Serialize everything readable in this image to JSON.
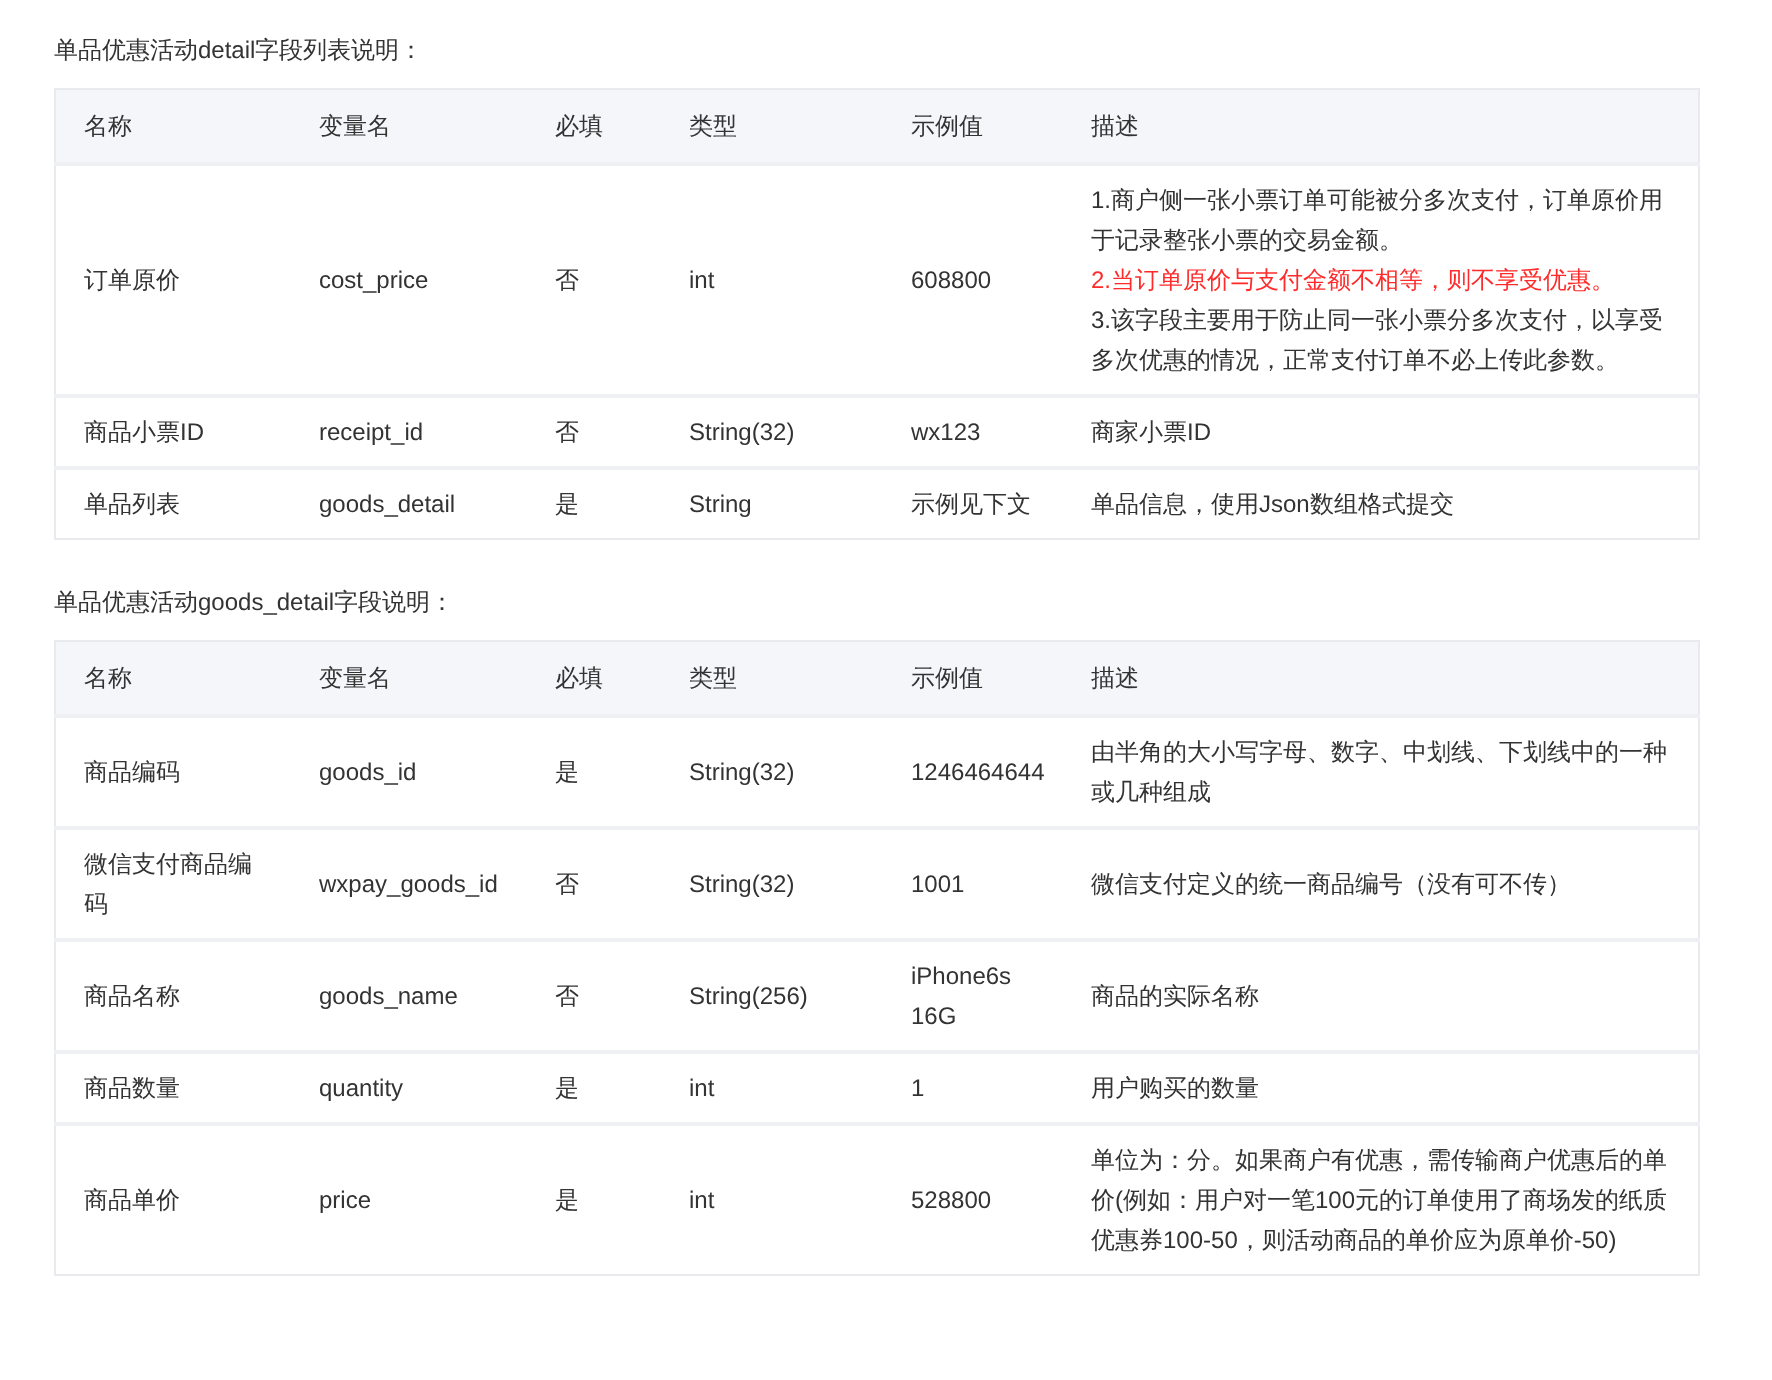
{
  "sections": [
    {
      "title": "单品优惠活动detail字段列表说明：",
      "columns": [
        "名称",
        "变量名",
        "必填",
        "类型",
        "示例值",
        "描述"
      ],
      "rows": [
        {
          "cells": [
            "订单原价",
            "cost_price",
            "否",
            "int",
            "608800"
          ],
          "description": [
            {
              "text": "1.商户侧一张小票订单可能被分多次支付，订单原价用于记录整张小票的交易金额。",
              "kind": "normal"
            },
            {
              "text": "2.当订单原价与支付金额不相等，则不享受优惠。",
              "kind": "warning"
            },
            {
              "text": "3.该字段主要用于防止同一张小票分多次支付，以享受多次优惠的情况，正常支付订单不必上传此参数。",
              "kind": "normal"
            }
          ]
        },
        {
          "cells": [
            "商品小票ID",
            "receipt_id",
            "否",
            "String(32)",
            "wx123"
          ],
          "description": [
            {
              "text": "商家小票ID",
              "kind": "normal"
            }
          ]
        },
        {
          "cells": [
            "单品列表",
            "goods_detail",
            "是",
            "String",
            "示例见下文"
          ],
          "description": [
            {
              "text": "单品信息，使用Json数组格式提交",
              "kind": "normal"
            }
          ]
        }
      ]
    },
    {
      "title": "单品优惠活动goods_detail字段说明：",
      "columns": [
        "名称",
        "变量名",
        "必填",
        "类型",
        "示例值",
        "描述"
      ],
      "rows": [
        {
          "cells": [
            "商品编码",
            "goods_id",
            "是",
            "String(32)",
            "1246464644"
          ],
          "description": [
            {
              "text": "由半角的大小写字母、数字、中划线、下划线中的一种或几种组成",
              "kind": "normal"
            }
          ]
        },
        {
          "cells": [
            "微信支付商品编码",
            "wxpay_goods_id",
            "否",
            "String(32)",
            "1001"
          ],
          "description": [
            {
              "text": "微信支付定义的统一商品编号（没有可不传）",
              "kind": "normal"
            }
          ]
        },
        {
          "cells": [
            "商品名称",
            "goods_name",
            "否",
            "String(256)",
            "iPhone6s 16G"
          ],
          "description": [
            {
              "text": "商品的实际名称",
              "kind": "normal"
            }
          ]
        },
        {
          "cells": [
            "商品数量",
            "quantity",
            "是",
            "int",
            "1"
          ],
          "description": [
            {
              "text": "用户购买的数量",
              "kind": "normal"
            }
          ]
        },
        {
          "cells": [
            "商品单价",
            "price",
            "是",
            "int",
            "528800"
          ],
          "description": [
            {
              "text": "单位为：分。如果商户有优惠，需传输商户优惠后的单价(例如：用户对一笔100元的订单使用了商场发的纸质优惠券100-50，则活动商品的单价应为原单价-50)",
              "kind": "normal"
            }
          ]
        }
      ]
    }
  ]
}
